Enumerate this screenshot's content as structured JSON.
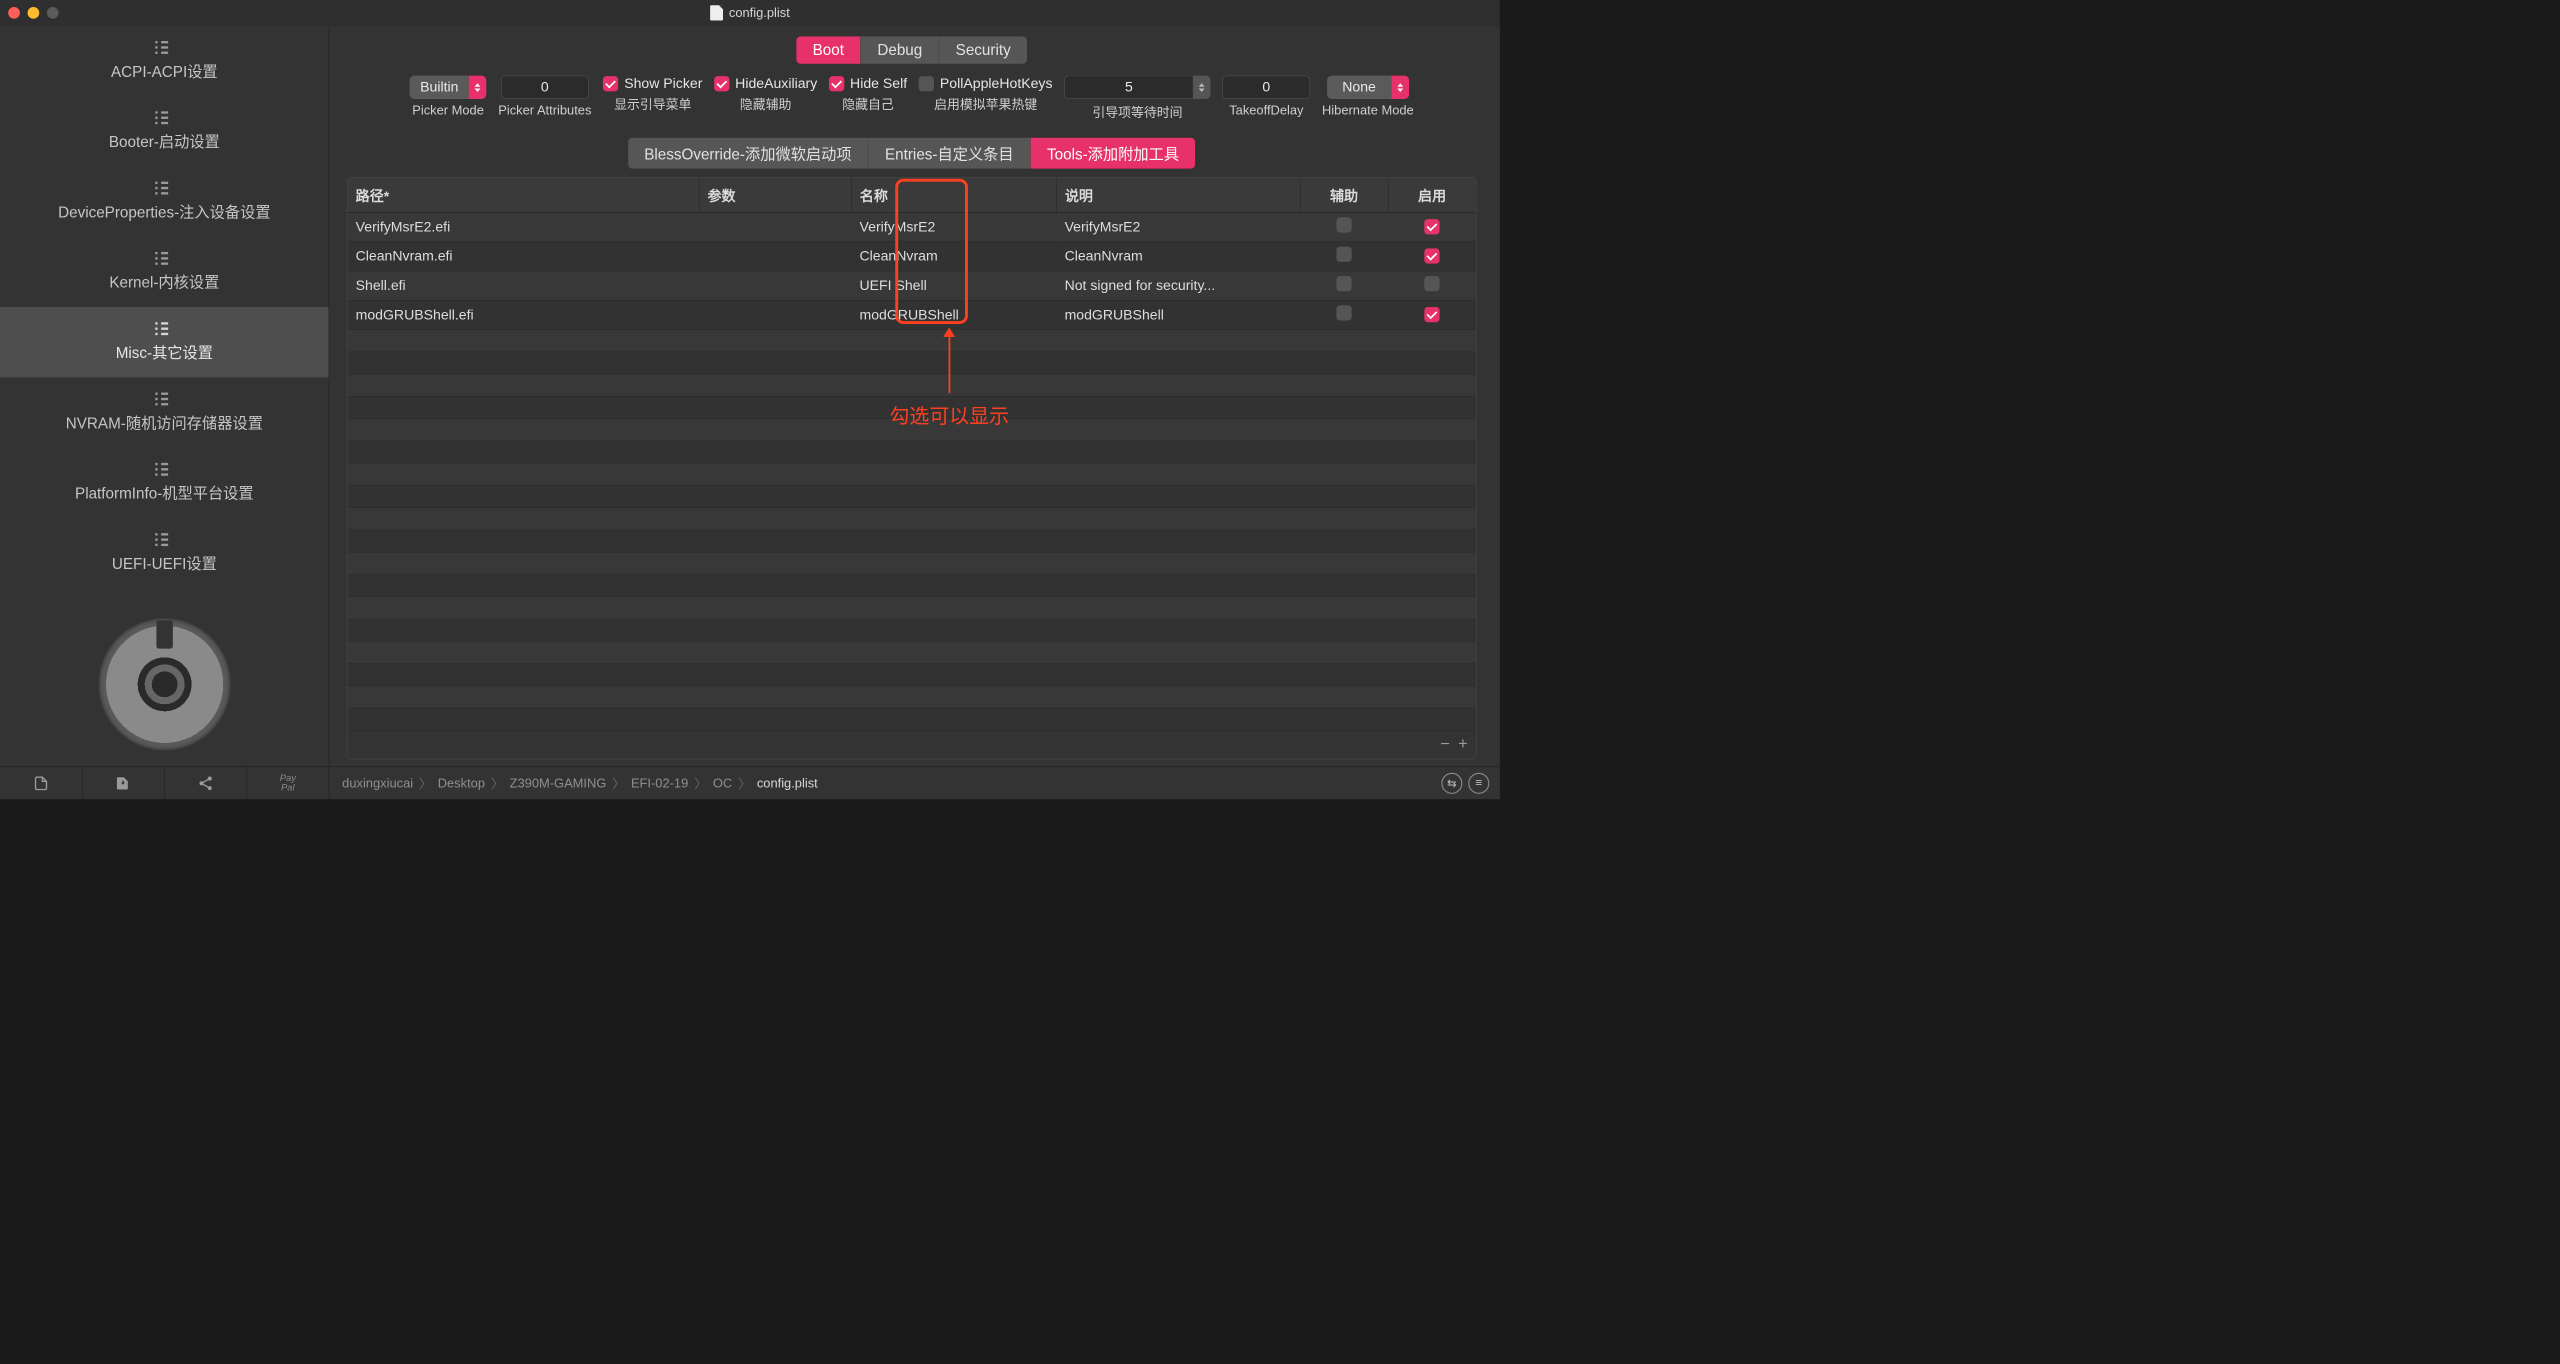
{
  "window": {
    "title": "config.plist"
  },
  "sidebar": {
    "items": [
      {
        "label": "ACPI-ACPI设置"
      },
      {
        "label": "Booter-启动设置"
      },
      {
        "label": "DeviceProperties-注入设备设置"
      },
      {
        "label": "Kernel-内核设置"
      },
      {
        "label": "Misc-其它设置"
      },
      {
        "label": "NVRAM-随机访问存储器设置"
      },
      {
        "label": "PlatformInfo-机型平台设置"
      },
      {
        "label": "UEFI-UEFI设置"
      }
    ],
    "selected_index": 4
  },
  "tabs_top": {
    "items": [
      "Boot",
      "Debug",
      "Security"
    ],
    "active_index": 0
  },
  "toolbar": {
    "picker_mode": {
      "value": "Builtin",
      "label": "Picker Mode"
    },
    "picker_attributes": {
      "value": "0",
      "label": "Picker Attributes"
    },
    "show_picker": {
      "checked": true,
      "label": "Show Picker",
      "sub": "显示引导菜单"
    },
    "hide_auxiliary": {
      "checked": true,
      "label": "HideAuxiliary",
      "sub": "隐藏辅助"
    },
    "hide_self": {
      "checked": true,
      "label": "Hide Self",
      "sub": "隐藏自己"
    },
    "poll_apple_hotkeys": {
      "checked": false,
      "label": "PollAppleHotKeys",
      "sub": "启用模拟苹果热键"
    },
    "timeout": {
      "value": "5",
      "label": "引导项等待时间"
    },
    "takeoff_delay": {
      "value": "0",
      "label": "TakeoffDelay"
    },
    "hibernate_mode": {
      "value": "None",
      "label": "Hibernate Mode"
    }
  },
  "tabs_sub": {
    "items": [
      "BlessOverride-添加微软启动项",
      "Entries-自定义条目",
      "Tools-添加附加工具"
    ],
    "active_index": 2
  },
  "table": {
    "columns": {
      "path": "路径*",
      "args": "参数",
      "name": "名称",
      "desc": "说明",
      "aux": "辅助",
      "enable": "启用"
    },
    "rows": [
      {
        "path": "VerifyMsrE2.efi",
        "args": "",
        "name": "VerifyMsrE2",
        "desc": "VerifyMsrE2",
        "aux": false,
        "enable": true
      },
      {
        "path": "CleanNvram.efi",
        "args": "",
        "name": "CleanNvram",
        "desc": "CleanNvram",
        "aux": false,
        "enable": true
      },
      {
        "path": "Shell.efi",
        "args": "",
        "name": "UEFI Shell",
        "desc": "Not signed for security...",
        "aux": false,
        "enable": false
      },
      {
        "path": "modGRUBShell.efi",
        "args": "",
        "name": "modGRUBShell",
        "desc": "modGRUBShell",
        "aux": false,
        "enable": true
      }
    ]
  },
  "annotation": {
    "text": "勾选可以显示"
  },
  "breadcrumbs": [
    "duxingxiucai",
    "Desktop",
    "Z390M-GAMING",
    "EFI-02-19",
    "OC",
    "config.plist"
  ]
}
